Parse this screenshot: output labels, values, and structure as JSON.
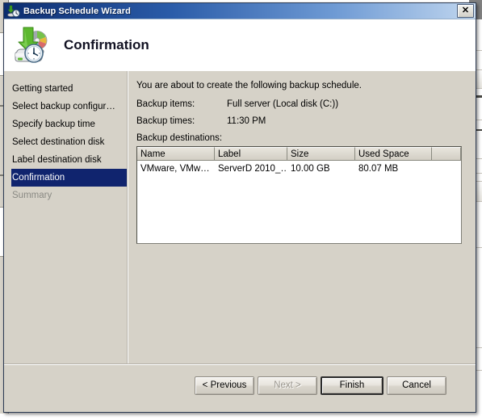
{
  "window": {
    "title": "Backup Schedule Wizard",
    "title_icon": "backup-schedule-icon",
    "close_label": "✕"
  },
  "header": {
    "title": "Confirmation",
    "icon": "backup-disk-clock-icon"
  },
  "sidebar": {
    "items": [
      {
        "label": "Getting started",
        "state": "normal"
      },
      {
        "label": "Select backup configur…",
        "state": "normal"
      },
      {
        "label": "Specify backup time",
        "state": "normal"
      },
      {
        "label": "Select destination disk",
        "state": "normal"
      },
      {
        "label": "Label destination disk",
        "state": "normal"
      },
      {
        "label": "Confirmation",
        "state": "selected"
      },
      {
        "label": "Summary",
        "state": "disabled"
      }
    ]
  },
  "content": {
    "intro": "You are about to create the following backup schedule.",
    "fields": [
      {
        "label": "Backup items:",
        "value": "Full server (Local disk (C:))"
      },
      {
        "label": "Backup times:",
        "value": "11:30 PM"
      }
    ],
    "destinations_label": "Backup destinations:",
    "table": {
      "columns": [
        "Name",
        "Label",
        "Size",
        "Used Space",
        ""
      ],
      "rows": [
        [
          "VMware, VMw…",
          "ServerD 2010_…",
          "10.00 GB",
          "80.07 MB",
          ""
        ]
      ]
    }
  },
  "footer": {
    "buttons": [
      {
        "label": "< Previous",
        "state": "normal"
      },
      {
        "label": "Next >",
        "state": "disabled"
      },
      {
        "label": "Finish",
        "state": "default"
      },
      {
        "label": "Cancel",
        "state": "normal"
      }
    ]
  },
  "colors": {
    "titlebar_start": "#0b2d6e",
    "titlebar_end": "#cfe0f2",
    "selection": "#10246e",
    "dialog_face": "#d6d2c8",
    "accent_green": "#3f9e21"
  }
}
